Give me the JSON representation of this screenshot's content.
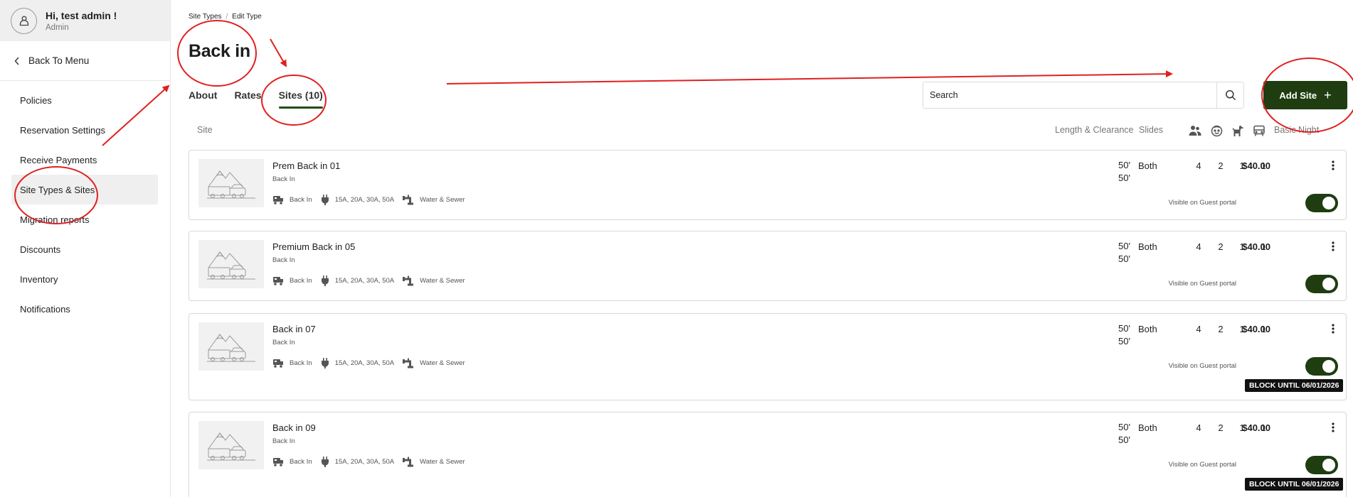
{
  "user": {
    "greeting": "Hi, test admin !",
    "role": "Admin"
  },
  "sidebar": {
    "back_label": "Back To Menu",
    "items": [
      {
        "label": "Policies"
      },
      {
        "label": "Reservation Settings"
      },
      {
        "label": "Receive Payments"
      },
      {
        "label": "Site Types & Sites"
      },
      {
        "label": "Migration reports"
      },
      {
        "label": "Discounts"
      },
      {
        "label": "Inventory"
      },
      {
        "label": "Notifications"
      }
    ],
    "active_item": "Site Types & Sites"
  },
  "breadcrumb": {
    "parent": "Site Types",
    "separator": "/",
    "current": "Edit Type"
  },
  "page_title": "Back in",
  "tabs": [
    {
      "label": "About"
    },
    {
      "label": "Rates"
    },
    {
      "label": "Sites (10)"
    }
  ],
  "active_tab": "Sites (10)",
  "search": {
    "placeholder": "Search"
  },
  "add_site_label": "Add Site",
  "columns": {
    "site": "Site",
    "length": "Length & Clearance",
    "slides": "Slides",
    "icons": [
      "adults-icon",
      "children-icon",
      "pets-icon",
      "vehicles-icon"
    ],
    "basic_night": "Basic Night"
  },
  "sites": [
    {
      "name": "Prem Back in 01",
      "type": "Back In",
      "amenity_parking": "Back In",
      "amenity_power": "15A, 20A, 30A, 50A",
      "amenity_water": "Water & Sewer",
      "length": "50'",
      "clearance": "50'",
      "slides": "Both",
      "adults": "4",
      "children": "2",
      "pets": "1",
      "vehicles": "1",
      "price": "$40.00",
      "visible_label": "Visible on Guest portal",
      "visible": true,
      "block": ""
    },
    {
      "name": "Premium Back in 05",
      "type": "Back In",
      "amenity_parking": "Back In",
      "amenity_power": "15A, 20A, 30A, 50A",
      "amenity_water": "Water & Sewer",
      "length": "50'",
      "clearance": "50'",
      "slides": "Both",
      "adults": "4",
      "children": "2",
      "pets": "1",
      "vehicles": "1",
      "price": "$40.00",
      "visible_label": "Visible on Guest portal",
      "visible": true,
      "block": ""
    },
    {
      "name": "Back in 07",
      "type": "Back In",
      "amenity_parking": "Back In",
      "amenity_power": "15A, 20A, 30A, 50A",
      "amenity_water": "Water & Sewer",
      "length": "50'",
      "clearance": "50'",
      "slides": "Both",
      "adults": "4",
      "children": "2",
      "pets": "1",
      "vehicles": "1",
      "price": "$40.00",
      "visible_label": "Visible on Guest portal",
      "visible": true,
      "block": "BLOCK UNTIL 06/01/2026"
    },
    {
      "name": "Back in 09",
      "type": "Back In",
      "amenity_parking": "Back In",
      "amenity_power": "15A, 20A, 30A, 50A",
      "amenity_water": "Water & Sewer",
      "length": "50'",
      "clearance": "50'",
      "slides": "Both",
      "adults": "4",
      "children": "2",
      "pets": "1",
      "vehicles": "1",
      "price": "$40.00",
      "visible_label": "Visible on Guest portal",
      "visible": true,
      "block": "BLOCK UNTIL 06/01/2026"
    }
  ],
  "colors": {
    "accent": "#1f3d10",
    "annotation": "#e02020",
    "active_bg": "#efefef",
    "badge": "#111111"
  }
}
